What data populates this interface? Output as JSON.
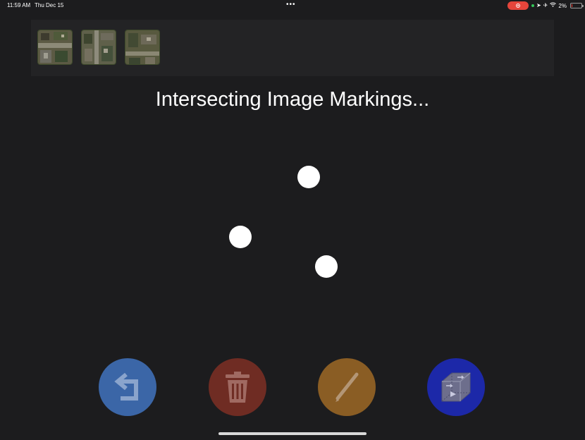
{
  "status_bar": {
    "time": "11:59 AM",
    "date": "Thu Dec 15",
    "battery_text": "2%",
    "icons": [
      "screen-record-icon",
      "location-icon",
      "airplane-icon",
      "wifi-icon",
      "battery-icon"
    ]
  },
  "thumbnails": [
    {
      "name": "aerial-image-1"
    },
    {
      "name": "aerial-image-2"
    },
    {
      "name": "aerial-image-3"
    }
  ],
  "title": "Intersecting Image Markings...",
  "markers_count": 3,
  "actions": [
    {
      "name": "undo-button",
      "icon": "undo-arrow-icon",
      "color": "#3b66a7"
    },
    {
      "name": "delete-button",
      "icon": "trash-icon",
      "color": "#6f2c23"
    },
    {
      "name": "draw-button",
      "icon": "pencil-icon",
      "color": "#8a5d24"
    },
    {
      "name": "3d-model-button",
      "icon": "cube-icon",
      "color": "#1c28a8"
    }
  ],
  "colors": {
    "background": "#1c1c1e",
    "strip": "#232325",
    "record": "#e5453b",
    "battery_low": "#ff3b30"
  }
}
